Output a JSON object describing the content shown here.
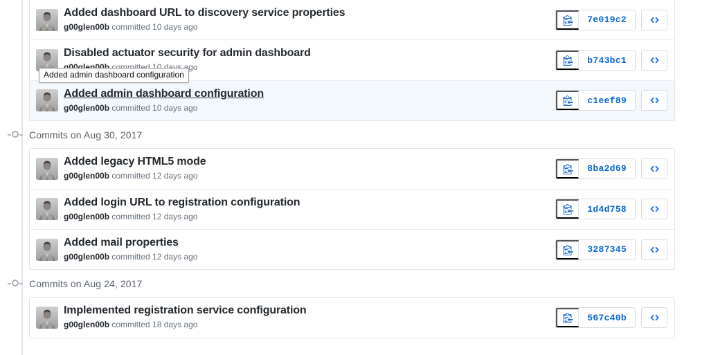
{
  "colors": {
    "link_blue": "#0366d6",
    "title_dark": "#24292e",
    "meta_gray": "#6a737d",
    "border_gray": "#e1e4e8",
    "selected_row_bg": "#f4f9fd",
    "rail_gray": "#e1e4e8"
  },
  "tooltip": {
    "text": "Added admin dashboard configuration"
  },
  "icons": {
    "copy": "clipboard-copy-icon",
    "code": "code-brackets-icon",
    "avatar": "user-avatar-photo",
    "node": "timeline-node-icon"
  },
  "groups": [
    {
      "header": null,
      "clipped_top": true,
      "commits": [
        {
          "title": "Added dashboard URL to discovery service properties",
          "author": "g00glen00b",
          "meta_suffix": "committed 10 days ago",
          "sha": "7e019c2",
          "selected": false
        },
        {
          "title": "Disabled actuator security for admin dashboard",
          "author": "g00glen00b",
          "meta_suffix": "committed 10 days ago",
          "sha": "b743bc1",
          "selected": false
        },
        {
          "title": "Added admin dashboard configuration",
          "author": "g00glen00b",
          "meta_suffix": "committed 10 days ago",
          "sha": "c1eef89",
          "selected": true
        }
      ]
    },
    {
      "header": "Commits on Aug 30, 2017",
      "clipped_top": false,
      "commits": [
        {
          "title": "Added legacy HTML5 mode",
          "author": "g00glen00b",
          "meta_suffix": "committed 12 days ago",
          "sha": "8ba2d69",
          "selected": false
        },
        {
          "title": "Added login URL to registration configuration",
          "author": "g00glen00b",
          "meta_suffix": "committed 12 days ago",
          "sha": "1d4d758",
          "selected": false
        },
        {
          "title": "Added mail properties",
          "author": "g00glen00b",
          "meta_suffix": "committed 12 days ago",
          "sha": "3287345",
          "selected": false
        }
      ]
    },
    {
      "header": "Commits on Aug 24, 2017",
      "clipped_top": false,
      "commits": [
        {
          "title": "Implemented registration service configuration",
          "author": "g00glen00b",
          "meta_suffix": "committed 18 days ago",
          "sha": "567c40b",
          "selected": false
        }
      ]
    }
  ]
}
